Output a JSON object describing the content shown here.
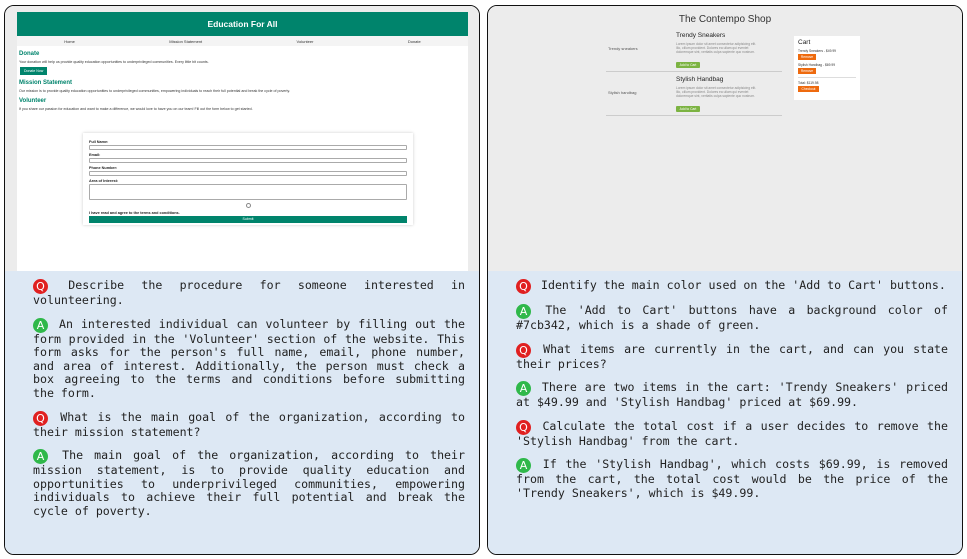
{
  "left": {
    "site": {
      "title": "Education For All",
      "nav": [
        "Home",
        "Mission Statement",
        "Volunteer",
        "Donate"
      ],
      "donate": {
        "heading": "Donate",
        "text": "Your donation will help us provide quality education opportunities to underprivileged communities. Every little bit counts.",
        "button": "Donate Now"
      },
      "mission": {
        "heading": "Mission Statement",
        "text": "Our mission is to provide quality education opportunities to underprivileged communities, empowering individuals to reach their full potential and break the cycle of poverty."
      },
      "volunteer": {
        "heading": "Volunteer",
        "text": "If you share our passion for education and want to make a difference, we would love to have you on our team! Fill out the form below to get started.",
        "labels": [
          "Full Name:",
          "Email:",
          "Phone Number:",
          "Area of Interest:"
        ],
        "terms": "I have read and agree to the terms and conditions.",
        "submit": "Submit"
      }
    },
    "qa": [
      {
        "q": "Describe the procedure for someone interested in volunteering.",
        "a": "An interested individual can volunteer by filling out the form provided in the 'Volunteer' section of the website. This form asks for the person's full name, email, phone number, and area of interest. Additionally, the person must check a box agreeing to the terms and conditions before submitting the form."
      },
      {
        "q": "What is the main goal of the organization, according to their mission statement?",
        "a": "The main goal of the organization, according to their mission statement, is to provide quality education and opportunities to underprivileged communities, empowering individuals to achieve their full potential and break the cycle of poverty."
      }
    ]
  },
  "right": {
    "site": {
      "title": "The Contempo Shop",
      "products": [
        {
          "img_alt": "Trendy sneakers",
          "name": "Trendy Sneakers",
          "desc": "Lorem ipsum dolor sit amet consectetur adipisicing elit. Illo, cillum provident. Dolores ea ullam qui eveniet doloremque sint, veritatis culpa sapiente quo nostrum.",
          "button": "Add to Cart"
        },
        {
          "img_alt": "Stylish handbag",
          "name": "Stylish Handbag",
          "desc": "Lorem ipsum dolor sit amet consectetur adipisicing elit. Illo, cillum provident. Dolores ea ullam qui eveniet doloremque sint, veritatis culpa sapiente quo nostrum.",
          "button": "Add to Cart"
        }
      ],
      "cart": {
        "title": "Cart",
        "items": [
          {
            "label": "Trendy Sneakers - $49.99",
            "button": "Remove"
          },
          {
            "label": "Stylish Handbag - $69.99",
            "button": "Remove"
          }
        ],
        "total": "Total: $119.98",
        "checkout": "Checkout"
      }
    },
    "qa": [
      {
        "q": "Identify the main color used on the 'Add to Cart' buttons.",
        "a": "The 'Add to Cart' buttons have a background color of #7cb342, which is a shade of green."
      },
      {
        "q": "What items are currently in the cart, and can you state their prices?",
        "a": "There are two items in the cart: 'Trendy Sneakers' priced at $49.99 and 'Stylish Handbag' priced at $69.99."
      },
      {
        "q": "Calculate the total cost if a user decides to remove the 'Stylish Handbag' from the cart.",
        "a": "If the 'Stylish Handbag', which costs $69.99, is removed from the cart, the total cost would be the price of the 'Trendy Sneakers', which is $49.99."
      }
    ]
  },
  "colors": {
    "edu_green": "#00846c",
    "add_to_cart": "#7cb342",
    "remove_orange": "#ee6a0e",
    "qa_bg": "#dde8f4",
    "q_badge": "#e02020",
    "a_badge": "#2fb84a"
  }
}
